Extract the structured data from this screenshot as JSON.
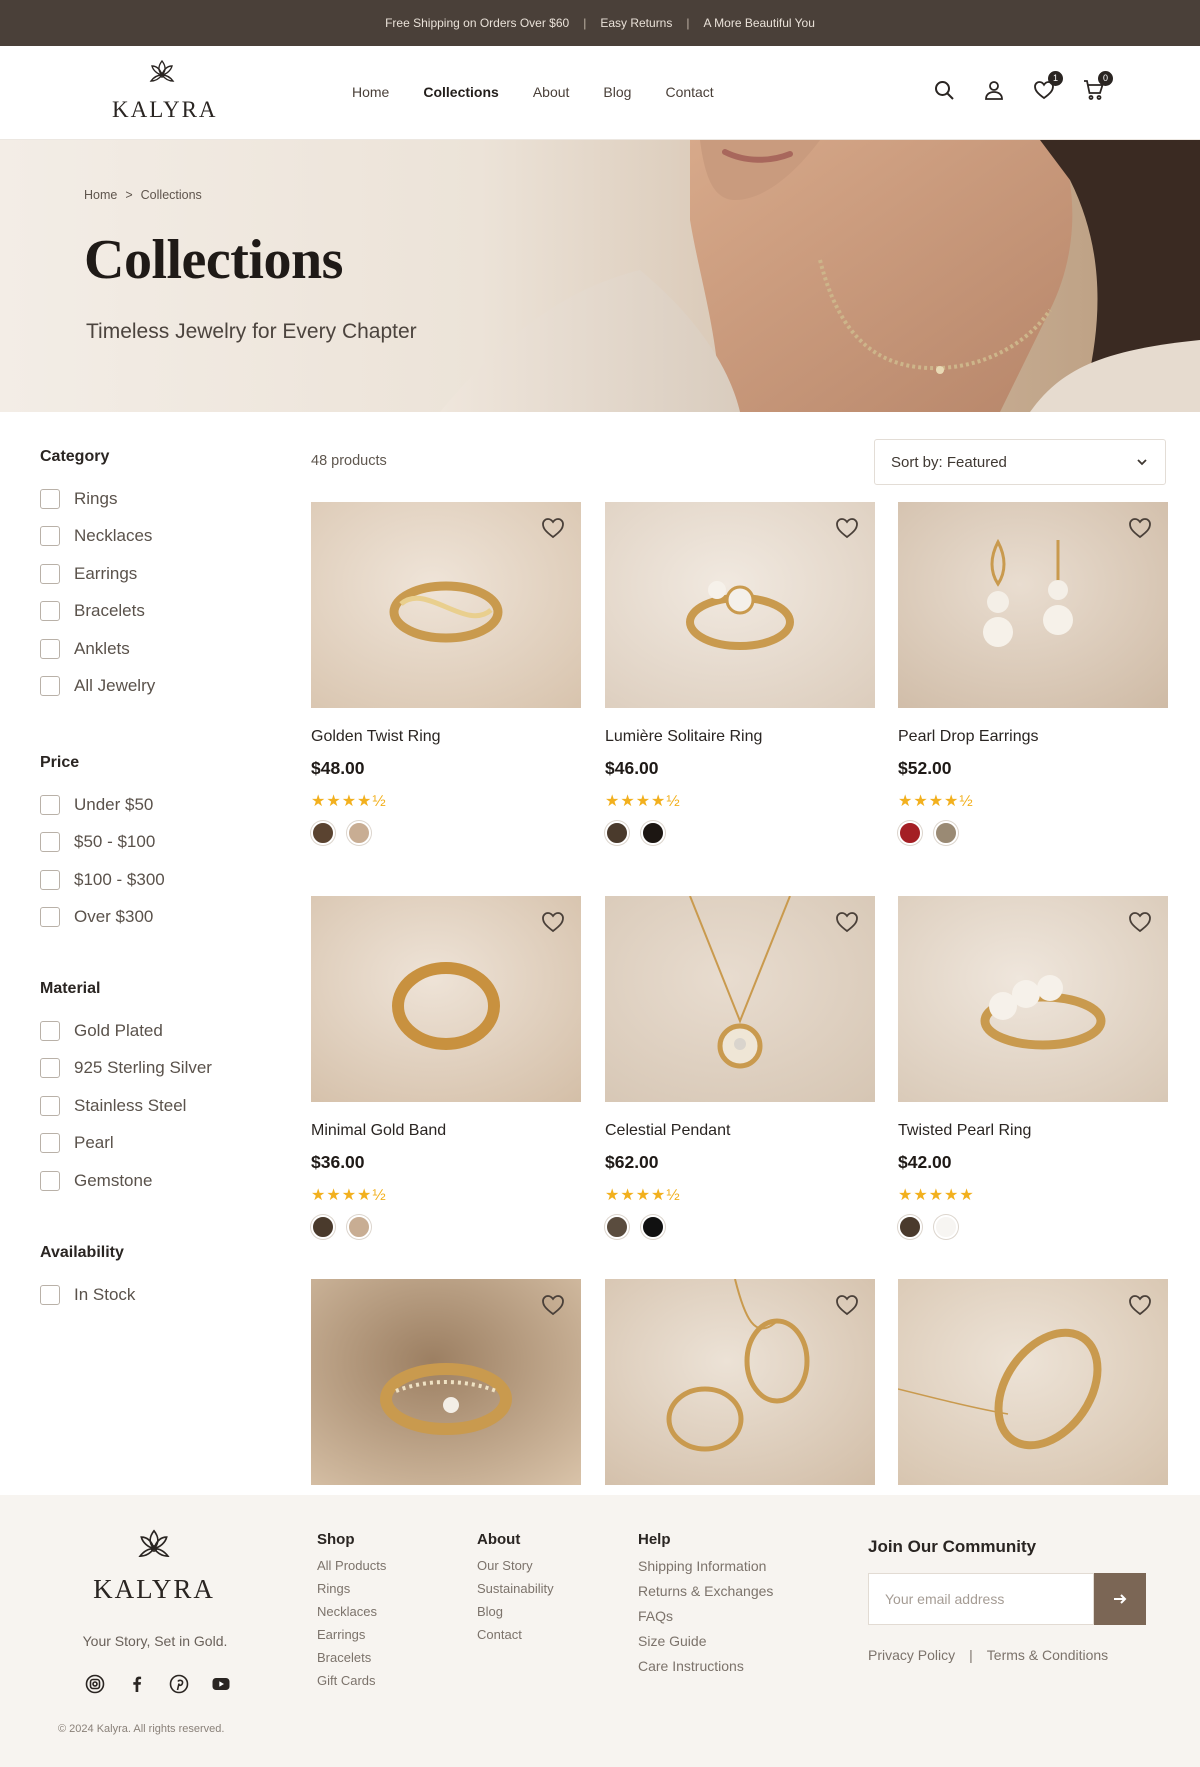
{
  "announcement": {
    "items": [
      "Free Shipping on Orders Over $60",
      "Easy Returns",
      "A More Beautiful You"
    ],
    "separator": "|"
  },
  "brand": {
    "name": "KALYRA"
  },
  "nav": {
    "items": [
      "Home",
      "Collections",
      "About",
      "Blog",
      "Contact"
    ],
    "active": "Collections"
  },
  "header_icons": {
    "search": "search-icon",
    "account": "user-icon",
    "wishlist": {
      "icon": "heart-icon",
      "count": "1"
    },
    "cart": {
      "icon": "cart-icon",
      "count": "0"
    }
  },
  "hero": {
    "breadcrumb": [
      "Home",
      "Collections"
    ],
    "breadcrumb_separator": ">",
    "title": "Collections",
    "subtitle": "Timeless Jewelry for Every Chapter"
  },
  "filters": {
    "category": {
      "title": "Category",
      "options": [
        "Rings",
        "Necklaces",
        "Earrings",
        "Bracelets",
        "Anklets",
        "All Jewelry"
      ]
    },
    "price": {
      "title": "Price",
      "options": [
        "Under $50",
        "$50 - $100",
        "$100 - $300",
        "Over $300"
      ]
    },
    "material": {
      "title": "Material",
      "options": [
        "Gold Plated",
        "925 Sterling Silver",
        "Stainless Steel",
        "Pearl",
        "Gemstone"
      ]
    },
    "availability": {
      "title": "Availability",
      "options": [
        "In Stock"
      ]
    }
  },
  "listing": {
    "count": "48 products",
    "sort_label": "Sort by:",
    "sort_value": "Featured"
  },
  "products": [
    {
      "name": "Golden Twist Ring",
      "price": "$48.00",
      "rating": 4.5,
      "stars": "★★★★½",
      "swatches": [
        "#5a4330",
        "#c8ad93"
      ]
    },
    {
      "name": "Lumière Solitaire Ring",
      "price": "$46.00",
      "rating": 4.5,
      "stars": "★★★★½",
      "swatches": [
        "#4a3a2c",
        "#1c1612"
      ]
    },
    {
      "name": "Pearl Drop Earrings",
      "price": "$52.00",
      "rating": 4.5,
      "stars": "★★★★½",
      "swatches": [
        "#a41f24",
        "#9a8a74"
      ]
    },
    {
      "name": "Minimal Gold Band",
      "price": "$36.00",
      "rating": 4.5,
      "stars": "★★★★½",
      "swatches": [
        "#4a3a2c",
        "#c8ad93"
      ]
    },
    {
      "name": "Celestial Pendant",
      "price": "$62.00",
      "rating": 4.5,
      "stars": "★★★★½",
      "swatches": [
        "#5a4c3e",
        "#111111"
      ]
    },
    {
      "name": "Twisted Pearl Ring",
      "price": "$42.00",
      "rating": 5,
      "stars": "★★★★★",
      "swatches": [
        "#4a3a2c",
        "#f7f5f2"
      ]
    },
    {
      "name": "",
      "price": "",
      "rating": null,
      "stars": "",
      "swatches": []
    },
    {
      "name": "",
      "price": "",
      "rating": null,
      "stars": "",
      "swatches": []
    },
    {
      "name": "",
      "price": "",
      "rating": null,
      "stars": "",
      "swatches": []
    }
  ],
  "footer": {
    "tagline": "Your Story, Set in Gold.",
    "social": [
      "instagram-icon",
      "facebook-icon",
      "pinterest-icon",
      "youtube-icon"
    ],
    "copyright": "© 2024 Kalyra. All rights reserved.",
    "columns": [
      {
        "title": "Shop",
        "links": [
          "All Products",
          "Rings",
          "Necklaces",
          "Earrings",
          "Bracelets",
          "Gift Cards"
        ]
      },
      {
        "title": "About",
        "links": [
          "Our Story",
          "Sustainability",
          "Blog",
          "Contact"
        ]
      },
      {
        "title": "Help",
        "links": [
          "Shipping Information",
          "Returns & Exchanges",
          "FAQs",
          "Size Guide",
          "Care Instructions"
        ]
      }
    ],
    "community": {
      "title": "Join Our Community",
      "placeholder": "Your email address"
    },
    "legal": [
      "Privacy Policy",
      "Terms & Conditions"
    ],
    "legal_separator": "|"
  },
  "colors": {
    "accent": "#7b6655",
    "announcement_bg": "#4a4039",
    "star": "#f2b01e"
  }
}
